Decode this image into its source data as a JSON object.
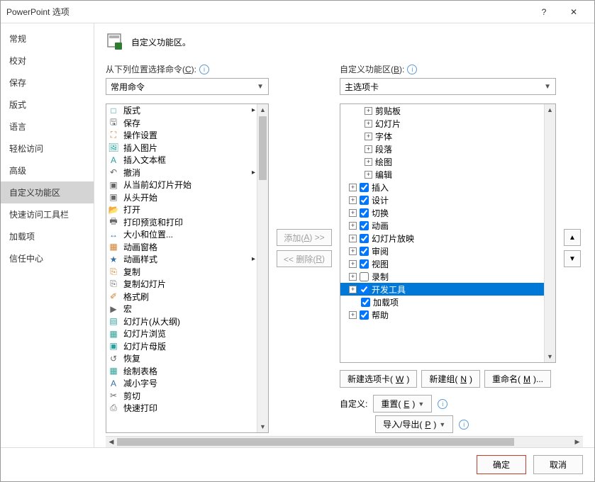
{
  "title": "PowerPoint 选项",
  "sidebar": {
    "items": [
      {
        "label": "常规"
      },
      {
        "label": "校对"
      },
      {
        "label": "保存"
      },
      {
        "label": "版式"
      },
      {
        "label": "语言"
      },
      {
        "label": "轻松访问"
      },
      {
        "label": "高级"
      },
      {
        "label": "自定义功能区"
      },
      {
        "label": "快速访问工具栏"
      },
      {
        "label": "加载项"
      },
      {
        "label": "信任中心"
      }
    ]
  },
  "header": {
    "title": "自定义功能区。"
  },
  "left": {
    "label_prefix": "从下列位置选择命令(",
    "label_accel": "C",
    "label_suffix": "):",
    "combo": "常用命令",
    "commands": [
      {
        "icon": "□",
        "label": "版式",
        "caret": true,
        "cls": "i-teal"
      },
      {
        "icon": "🖫",
        "label": "保存"
      },
      {
        "icon": "⛶",
        "label": "操作设置",
        "cls": "i-orange"
      },
      {
        "icon": "🖼",
        "label": "插入图片",
        "cls": "i-teal"
      },
      {
        "icon": "A",
        "label": "插入文本框",
        "cls": "i-teal"
      },
      {
        "icon": "↶",
        "label": "撤消",
        "caret": true
      },
      {
        "icon": "▣",
        "label": "从当前幻灯片开始"
      },
      {
        "icon": "▣",
        "label": "从头开始"
      },
      {
        "icon": "📂",
        "label": "打开",
        "cls": "i-orange"
      },
      {
        "icon": "🖶",
        "label": "打印预览和打印"
      },
      {
        "icon": "↔",
        "label": "大小和位置...",
        "cls": "i-blue"
      },
      {
        "icon": "▦",
        "label": "动画窗格",
        "cls": "i-orange"
      },
      {
        "icon": "★",
        "label": "动画样式",
        "caret": true,
        "cls": "i-blue"
      },
      {
        "icon": "⎘",
        "label": "复制",
        "cls": "i-orange"
      },
      {
        "icon": "⎘",
        "label": "复制幻灯片"
      },
      {
        "icon": "✐",
        "label": "格式刷",
        "cls": "i-orange"
      },
      {
        "icon": "▶",
        "label": "宏"
      },
      {
        "icon": "▤",
        "label": "幻灯片(从大纲)",
        "cls": "i-teal"
      },
      {
        "icon": "▦",
        "label": "幻灯片浏览",
        "cls": "i-teal"
      },
      {
        "icon": "▣",
        "label": "幻灯片母版",
        "cls": "i-teal"
      },
      {
        "icon": "↺",
        "label": "恢复"
      },
      {
        "icon": "▦",
        "label": "绘制表格",
        "cls": "i-teal"
      },
      {
        "icon": "A",
        "label": "减小字号",
        "cls": "i-blue"
      },
      {
        "icon": "✂",
        "label": "剪切"
      },
      {
        "icon": "⎙",
        "label": "快速打印"
      }
    ]
  },
  "mid": {
    "add_prefix": "添加(",
    "add_accel": "A",
    "add_suffix": ") >>",
    "remove_prefix": "<< 删除(",
    "remove_accel": "R",
    "remove_suffix": ")"
  },
  "right": {
    "label_prefix": "自定义功能区(",
    "label_accel": "B",
    "label_suffix": "):",
    "combo": "主选项卡",
    "tree": [
      {
        "level": 1,
        "exp": "+",
        "label": "剪贴板"
      },
      {
        "level": 1,
        "exp": "+",
        "label": "幻灯片"
      },
      {
        "level": 1,
        "exp": "+",
        "label": "字体"
      },
      {
        "level": 1,
        "exp": "+",
        "label": "段落"
      },
      {
        "level": 1,
        "exp": "+",
        "label": "绘图"
      },
      {
        "level": 1,
        "exp": "+",
        "label": "编辑"
      },
      {
        "level": 0,
        "exp": "+",
        "check": true,
        "label": "插入"
      },
      {
        "level": 0,
        "exp": "+",
        "check": true,
        "label": "设计"
      },
      {
        "level": 0,
        "exp": "+",
        "check": true,
        "label": "切换"
      },
      {
        "level": 0,
        "exp": "+",
        "check": true,
        "label": "动画"
      },
      {
        "level": 0,
        "exp": "+",
        "check": true,
        "label": "幻灯片放映"
      },
      {
        "level": 0,
        "exp": "+",
        "check": true,
        "label": "审阅"
      },
      {
        "level": 0,
        "exp": "+",
        "check": true,
        "label": "视图"
      },
      {
        "level": 0,
        "exp": "+",
        "check": false,
        "label": "录制"
      },
      {
        "level": 0,
        "exp": "+",
        "check": true,
        "label": "开发工具",
        "selected": true
      },
      {
        "level": 0,
        "exp": "",
        "check": true,
        "label": "加载项"
      },
      {
        "level": 0,
        "exp": "+",
        "check": true,
        "label": "帮助"
      }
    ],
    "btn_newtab_p": "新建选项卡(",
    "btn_newtab_a": "W",
    "btn_newtab_s": ")",
    "btn_newgroup_p": "新建组(",
    "btn_newgroup_a": "N",
    "btn_newgroup_s": ")",
    "btn_rename_p": "重命名(",
    "btn_rename_a": "M",
    "btn_rename_s": ")...",
    "customize_label": "自定义:",
    "btn_reset_p": "重置(",
    "btn_reset_a": "E",
    "btn_reset_s": ")",
    "btn_io_p": "导入/导出(",
    "btn_io_a": "P",
    "btn_io_s": ")"
  },
  "footer": {
    "ok": "确定",
    "cancel": "取消"
  }
}
